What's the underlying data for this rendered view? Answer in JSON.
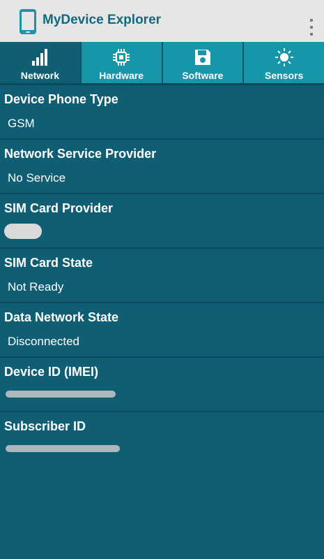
{
  "app": {
    "title": "MyDevice Explorer",
    "icon": "phone-icon",
    "menu_icon": "overflow-menu-icon"
  },
  "tabs": [
    {
      "label": "Network",
      "icon": "signal-bars-icon",
      "active": true
    },
    {
      "label": "Hardware",
      "icon": "chip-icon",
      "active": false
    },
    {
      "label": "Software",
      "icon": "floppy-disk-icon",
      "active": false
    },
    {
      "label": "Sensors",
      "icon": "sun-icon",
      "active": false
    }
  ],
  "rows": [
    {
      "label": "Device Phone Type",
      "value": "GSM"
    },
    {
      "label": "Network Service Provider",
      "value": "No Service"
    },
    {
      "label": "SIM Card Provider",
      "value": ""
    },
    {
      "label": "SIM Card State",
      "value": "Not Ready"
    },
    {
      "label": "Data Network State",
      "value": "Disconnected"
    },
    {
      "label": "Device ID (IMEI)",
      "value": ""
    },
    {
      "label": "Subscriber ID",
      "value": ""
    }
  ],
  "colors": {
    "background": "#0f5e73",
    "appbar": "#e6e6e6",
    "title": "#136a80",
    "tab": "#1796aa",
    "divider": "#0a4a5a"
  }
}
